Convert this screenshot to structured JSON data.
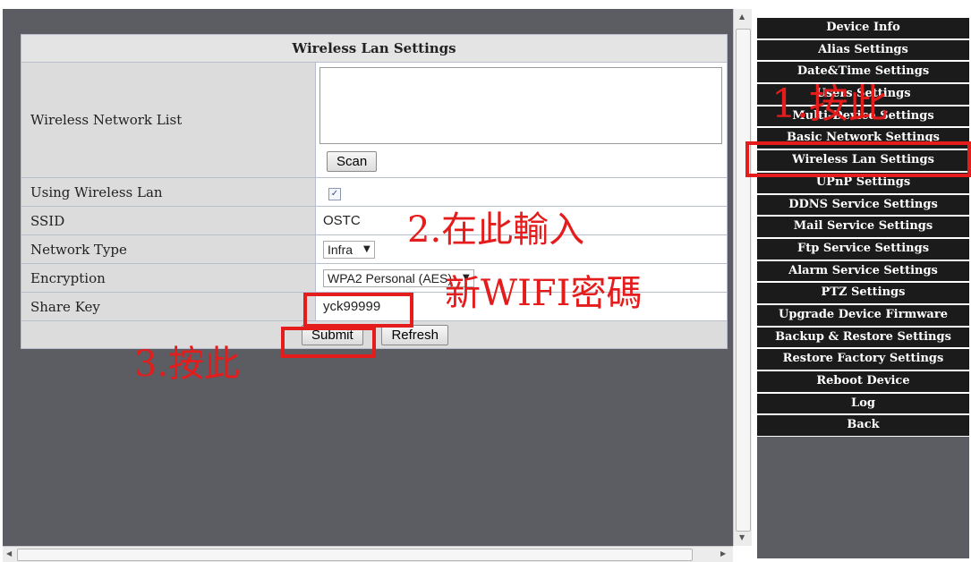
{
  "settings": {
    "title": "Wireless Lan Settings",
    "wireless_network_list_label": "Wireless Network List",
    "scan_button": "Scan",
    "using_wireless_label": "Using Wireless Lan",
    "using_wireless_checked": true,
    "checkmark": "✓",
    "ssid_label": "SSID",
    "ssid_value": "OSTC",
    "network_type_label": "Network Type",
    "network_type_value": "Infra",
    "encryption_label": "Encryption",
    "encryption_value": "WPA2 Personal (AES)",
    "share_key_label": "Share Key",
    "share_key_value": "yck99999",
    "submit_button": "Submit",
    "refresh_button": "Refresh"
  },
  "sidebar": {
    "items": [
      {
        "label": "Device Info"
      },
      {
        "label": "Alias Settings"
      },
      {
        "label": "Date&Time Settings"
      },
      {
        "label": "Users Settings"
      },
      {
        "label": "Multi-Device Settings"
      },
      {
        "label": "Basic Network Settings"
      },
      {
        "label": "Wireless Lan Settings"
      },
      {
        "label": "UPnP Settings"
      },
      {
        "label": "DDNS Service Settings"
      },
      {
        "label": "Mail Service Settings"
      },
      {
        "label": "Ftp Service Settings"
      },
      {
        "label": "Alarm Service Settings"
      },
      {
        "label": "PTZ Settings"
      },
      {
        "label": "Upgrade Device Firmware"
      },
      {
        "label": "Backup & Restore Settings"
      },
      {
        "label": "Restore Factory Settings"
      },
      {
        "label": "Reboot Device"
      },
      {
        "label": "Log"
      },
      {
        "label": "Back"
      }
    ]
  },
  "annotations": {
    "step1": "1.按此",
    "step2_line1": "2.在此輸入",
    "step2_line2": "新WIFI密碼",
    "step3": "3.按此"
  },
  "icons": {
    "scroll_up": "▲",
    "scroll_down": "▼",
    "scroll_left": "◀",
    "scroll_right": "▶",
    "dropdown_caret": "▼"
  },
  "colors": {
    "annotation_red": "#e41c1c",
    "sidebar_bg": "#1b1b1b",
    "page_bg": "#5c5d63"
  }
}
